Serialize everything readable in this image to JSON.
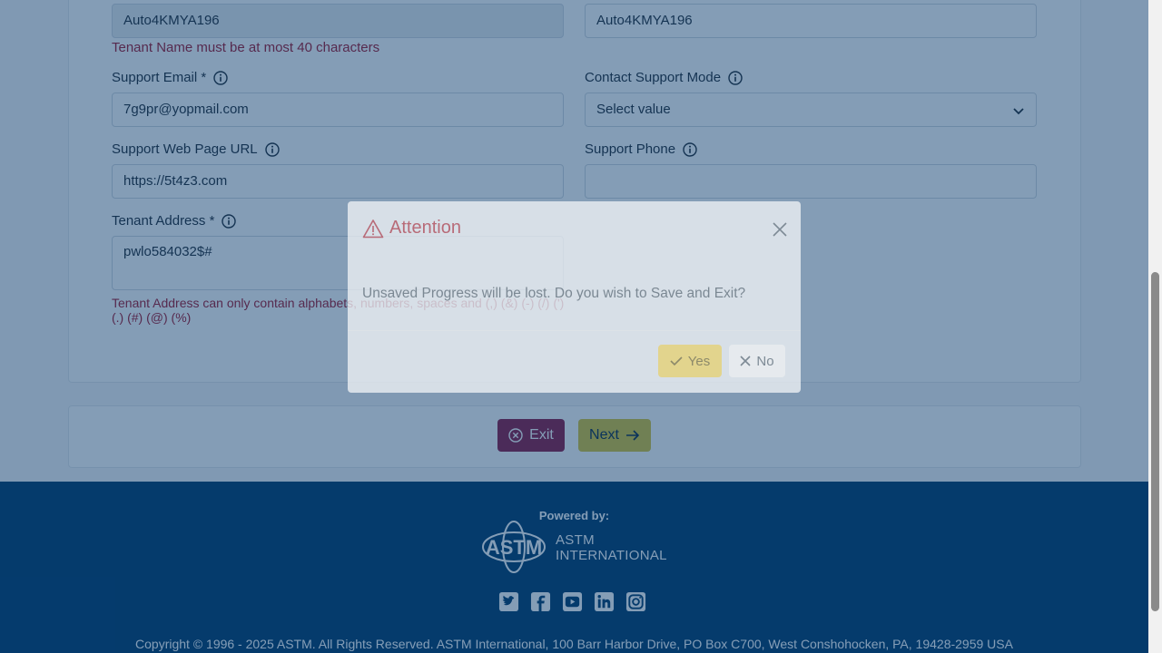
{
  "form": {
    "tenant_name_value": "Auto4KMYA196",
    "display_name_value": "Auto4KMYA196",
    "tenant_name_error": "Tenant Name must be at most 40 characters",
    "support_email_label": "Support Email *",
    "support_email_value": "7g9pr@yopmail.com",
    "contact_mode_label": "Contact Support Mode",
    "contact_mode_value": "Select value",
    "support_web_label": "Support Web Page URL",
    "support_web_value": "https://5t4z3.com",
    "support_phone_label": "Support Phone",
    "support_phone_value": "",
    "tenant_address_label": "Tenant Address *",
    "tenant_address_value": "pwlo584032$#",
    "tenant_address_error": "Tenant Address can only contain alphabets, numbers, spaces and (,) (&) (-) (/) (') (.) (#) (@) (%)"
  },
  "actions": {
    "exit_label": "Exit",
    "next_label": "Next"
  },
  "footer": {
    "powered_by": "Powered by:",
    "logo_line1": "ASTM",
    "logo_line2": "INTERNATIONAL",
    "social_icons": [
      "twitter-icon",
      "facebook-icon",
      "youtube-icon",
      "linkedin-icon",
      "instagram-icon"
    ],
    "copyright": "Copyright © 1996 - 2025 ASTM. All Rights Reserved. ASTM International, 100 Barr Harbor Drive, PO Box C700, West Conshohocken, PA, 19428-2959 USA"
  },
  "modal": {
    "title": "Attention",
    "message": "Unsaved Progress will be lost. Do you wish to Save and Exit?",
    "yes_label": "Yes",
    "no_label": "No"
  },
  "colors": {
    "exit_button": "#8c1b45",
    "next_button": "#d6c53a",
    "footer_bg": "#003a6b",
    "error_text": "#a3182f"
  }
}
